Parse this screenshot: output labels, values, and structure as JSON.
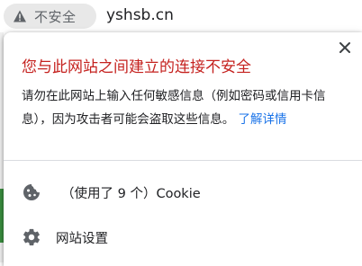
{
  "address_bar": {
    "security_label": "不安全",
    "url": "yshsb.cn",
    "icon": "warning-triangle-icon"
  },
  "popup": {
    "title": "您与此网站之间建立的连接不安全",
    "description": "请勿在此网站上输入任何敏感信息（例如密码或信用卡信息），因为攻击者可能会盗取这些信息。",
    "learn_more": "了解详情",
    "cookie_row": {
      "label": "（使用了 9 个）Cookie",
      "icon": "cookie-icon"
    },
    "settings_row": {
      "label": "网站设置",
      "icon": "gear-icon"
    },
    "close_icon": "close-icon"
  },
  "colors": {
    "title_red": "#c5221f",
    "link_blue": "#1a73e8",
    "chip_bg": "#e8e8e8"
  }
}
